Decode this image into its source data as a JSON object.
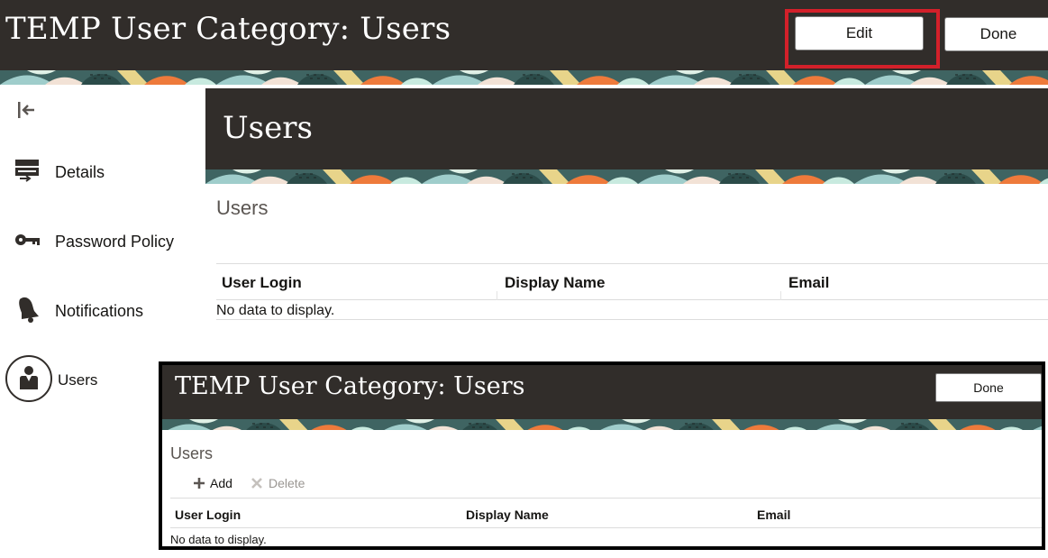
{
  "header": {
    "title": "TEMP User Category: Users",
    "edit_label": "Edit",
    "done_label": "Done"
  },
  "sidebar": {
    "items": [
      {
        "label": "Details",
        "icon": "details-icon"
      },
      {
        "label": "Password Policy",
        "icon": "key-icon"
      },
      {
        "label": "Notifications",
        "icon": "bell-icon"
      },
      {
        "label": "Users",
        "icon": "user-icon"
      }
    ],
    "selected": "Users"
  },
  "section": {
    "title": "Users"
  },
  "users_table": {
    "heading": "Users",
    "columns": [
      "User Login",
      "Display Name",
      "Email"
    ],
    "empty_text": "No data to display."
  },
  "inset": {
    "title": "TEMP User Category: Users",
    "done_label": "Done",
    "heading": "Users",
    "toolbar": {
      "add_label": "Add",
      "delete_label": "Delete"
    },
    "columns": [
      "User Login",
      "Display Name",
      "Email"
    ],
    "empty_text": "No data to display."
  },
  "colors": {
    "header_bg": "#312d2a",
    "highlight": "#d3202a",
    "teal": "#4c8a8a",
    "orange": "#ee7a3b",
    "mint": "#cde6d8"
  }
}
